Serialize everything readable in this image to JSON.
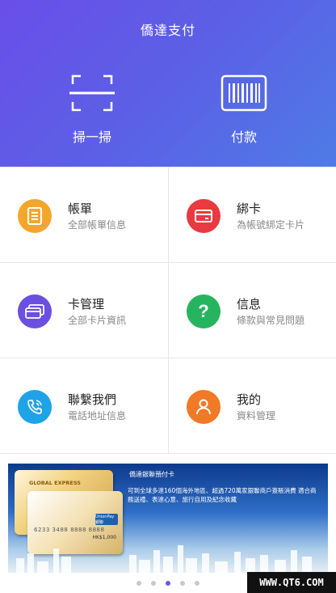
{
  "header": {
    "title": "僑達支付",
    "scan_label": "掃一掃",
    "pay_label": "付款",
    "scan_icon": "scan-icon",
    "pay_icon": "barcode-icon"
  },
  "menu": [
    {
      "title": "帳單",
      "subtitle": "全部帳單信息",
      "icon": "bill-icon",
      "color": "#f4a62c"
    },
    {
      "title": "綁卡",
      "subtitle": "為帳號綁定卡片",
      "icon": "card-icon",
      "color": "#e83a3f"
    },
    {
      "title": "卡管理",
      "subtitle": "全部卡片資訊",
      "icon": "cards-icon",
      "color": "#6a4fe0"
    },
    {
      "title": "信息",
      "subtitle": "條款與常見問題",
      "icon": "question-icon",
      "color": "#27b45e"
    },
    {
      "title": "聯繫我們",
      "subtitle": "電話地址信息",
      "icon": "phone-icon",
      "color": "#1ea3e8"
    },
    {
      "title": "我的",
      "subtitle": "資料管理",
      "icon": "user-icon",
      "color": "#f07a25"
    }
  ],
  "banner": {
    "title": "僑達銀聯預付卡",
    "text": "可到全球多達160個海外地區、超過720萬家銀聯商戶簽賬消費 適合商務送禮、表達心意、旅行自用及紀念收藏",
    "card_brand": "GLOBAL EXPRESS",
    "card_number": "6233 3488 8888 8888",
    "card_amount": "HK$1,000",
    "card_network": "UnionPay 銀聯"
  },
  "carousel": {
    "count": 5,
    "active": 2
  },
  "watermark": "WWW.QT6.COM"
}
